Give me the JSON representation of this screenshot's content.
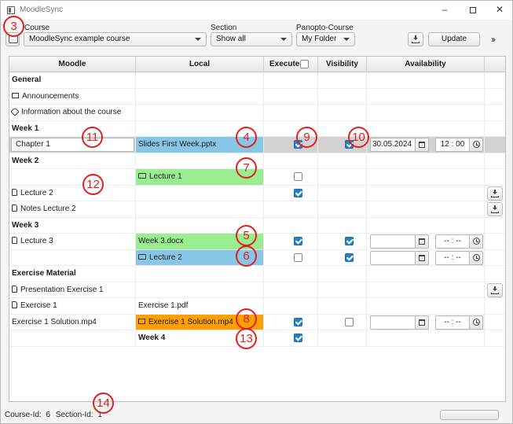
{
  "window": {
    "title": "MoodleSync"
  },
  "toolbar": {
    "course_label": "Course",
    "course_value": "MoodleSync example course",
    "section_label": "Section",
    "section_value": "Show all",
    "panopto_label": "Panopto-Course",
    "panopto_value": "My Folder",
    "update_label": "Update",
    "more_label": "››"
  },
  "table": {
    "headers": {
      "moodle": "Moodle",
      "local": "Local",
      "execute": "Execute",
      "visibility": "Visibility",
      "availability": "Availability"
    },
    "rows": [
      {
        "moodle": "General",
        "moodle_bold": true
      },
      {
        "moodle": "Announcements",
        "moodle_icon": "forum-icon"
      },
      {
        "moodle": "Information about the course",
        "moodle_icon": "label-icon"
      },
      {
        "moodle": "Week 1",
        "moodle_bold": true
      },
      {
        "moodle_input": "Chapter 1",
        "local": "Slides First Week.pptx",
        "local_color": "blue",
        "execute": true,
        "visibility": true,
        "date": "30.05.2024",
        "time": "12 : 00"
      },
      {
        "moodle": "Week 2",
        "moodle_bold": true
      },
      {
        "local": "Lecture 1",
        "local_icon": "folder-icon",
        "local_color": "green",
        "execute": false
      },
      {
        "moodle": "Lecture 2",
        "moodle_icon": "file-icon",
        "execute": true,
        "download": true
      },
      {
        "moodle": "Notes Lecture 2",
        "moodle_icon": "file-icon",
        "download": true
      },
      {
        "moodle": "Week 3",
        "moodle_bold": true
      },
      {
        "moodle": "Lecture 3",
        "moodle_icon": "file-icon",
        "local": "Week 3.docx",
        "local_color": "green",
        "execute": true,
        "visibility": true,
        "date": "",
        "time": "-- : --"
      },
      {
        "local": "Lecture 2",
        "local_icon": "folder-icon",
        "local_color": "blue",
        "execute": false,
        "visibility": true,
        "date": "",
        "time": "-- : --"
      },
      {
        "moodle": "Exercise Material",
        "moodle_bold": true
      },
      {
        "moodle": "Presentation Exercise 1",
        "moodle_icon": "file-icon",
        "download": true
      },
      {
        "moodle": "Exercise 1",
        "moodle_icon": "file-icon",
        "local": "Exercise 1.pdf"
      },
      {
        "moodle": "Exercise 1 Solution.mp4",
        "local": "Exercise 1 Solution.mp4",
        "local_icon": "video-icon",
        "local_color": "orange",
        "execute": true,
        "visibility": false,
        "date": "",
        "time": "-- : --"
      },
      {
        "local": "Week 4",
        "local_bold": true,
        "execute": true
      }
    ]
  },
  "markers": [
    "3",
    "4",
    "5",
    "6",
    "7",
    "8",
    "9",
    "10",
    "11",
    "12",
    "13",
    "14"
  ],
  "status": {
    "course_id_label": "Course-Id:",
    "course_id": "6",
    "section_id_label": "Section-Id:",
    "section_id": "1"
  },
  "colors": {
    "blue": "#87c6e6",
    "green": "#98ee90",
    "orange": "#ff9f00",
    "marker": "#e0201e",
    "checkbox": "#2680c6"
  }
}
